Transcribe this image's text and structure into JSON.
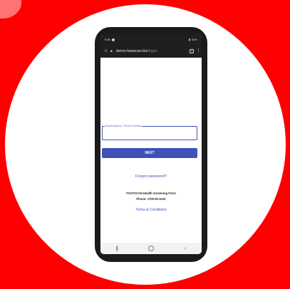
{
  "status_bar": {
    "time": "5:46",
    "right_text": "61%"
  },
  "browser": {
    "url_domain": "demo.fastscan.biz",
    "url_path": "/login",
    "tab_count": "1"
  },
  "login": {
    "field_label": "Email Address / Phone Number",
    "field_value": "",
    "next_label": "NEXT",
    "forgot_label": "Forgot password?"
  },
  "footer": {
    "org_name": "FASTSCAN Health Screening Form",
    "phone": "Phone: 1700-81-6110",
    "terms_label": "Terms & Conditions"
  },
  "colors": {
    "background": "#ff0000",
    "accent": "#3f51b5"
  }
}
